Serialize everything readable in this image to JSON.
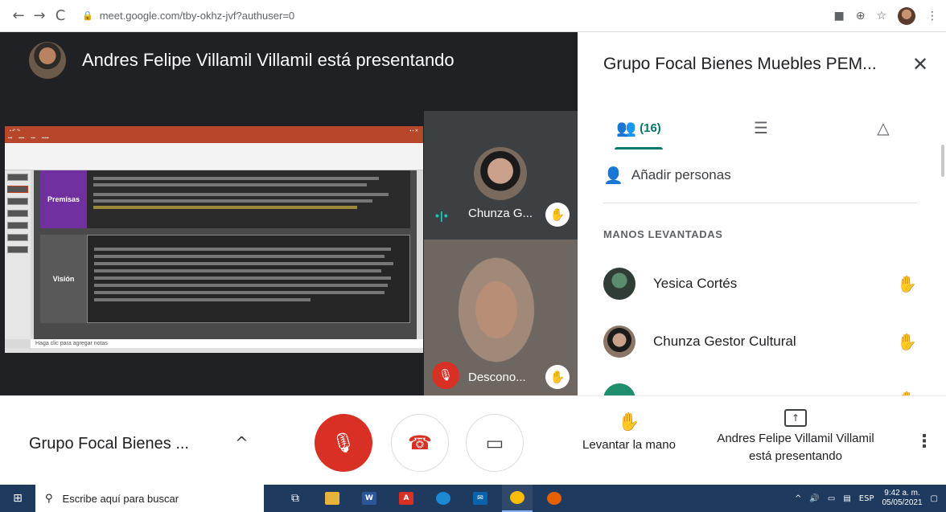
{
  "browser": {
    "back": "←",
    "forward": "→",
    "reload": "C",
    "url": "meet.google.com/tby-okhz-jvf?authuser=0"
  },
  "stage": {
    "presenting_title": "Andres Felipe Villamil Villamil está presentando"
  },
  "slide": {
    "premisas_label": "Premisas",
    "vision_label": "Visión",
    "notes_placeholder": "Haga clic para agregar notas"
  },
  "tiles": [
    {
      "name": "Chunza G...",
      "state": "speaking"
    },
    {
      "name": "Descono...",
      "state": "muted"
    }
  ],
  "panel": {
    "title": "Grupo Focal Bienes Muebles PEM...",
    "people_count": "(16)",
    "add_people": "Añadir personas",
    "section_label": "MANOS LEVANTADAS",
    "participants": [
      {
        "name": "Yesica Cortés"
      },
      {
        "name": "Chunza Gestor Cultural"
      },
      {
        "name": ""
      }
    ]
  },
  "bottom": {
    "meeting_name": "Grupo Focal Bienes ...",
    "raise_hand": "Levantar la mano",
    "presenting_line1": "Andres Felipe Villamil Villamil",
    "presenting_line2": "está presentando"
  },
  "taskbar": {
    "search_placeholder": "Escribe aquí para buscar",
    "language": "ESP",
    "time": "9:42 a. m.",
    "date": "05/05/2021"
  },
  "colors": {
    "meet_red": "#d93025",
    "meet_teal": "#00796b",
    "stage_bg": "#202124",
    "taskbar_bg": "#1f3a5f",
    "premisas_purple": "#7030a0"
  }
}
